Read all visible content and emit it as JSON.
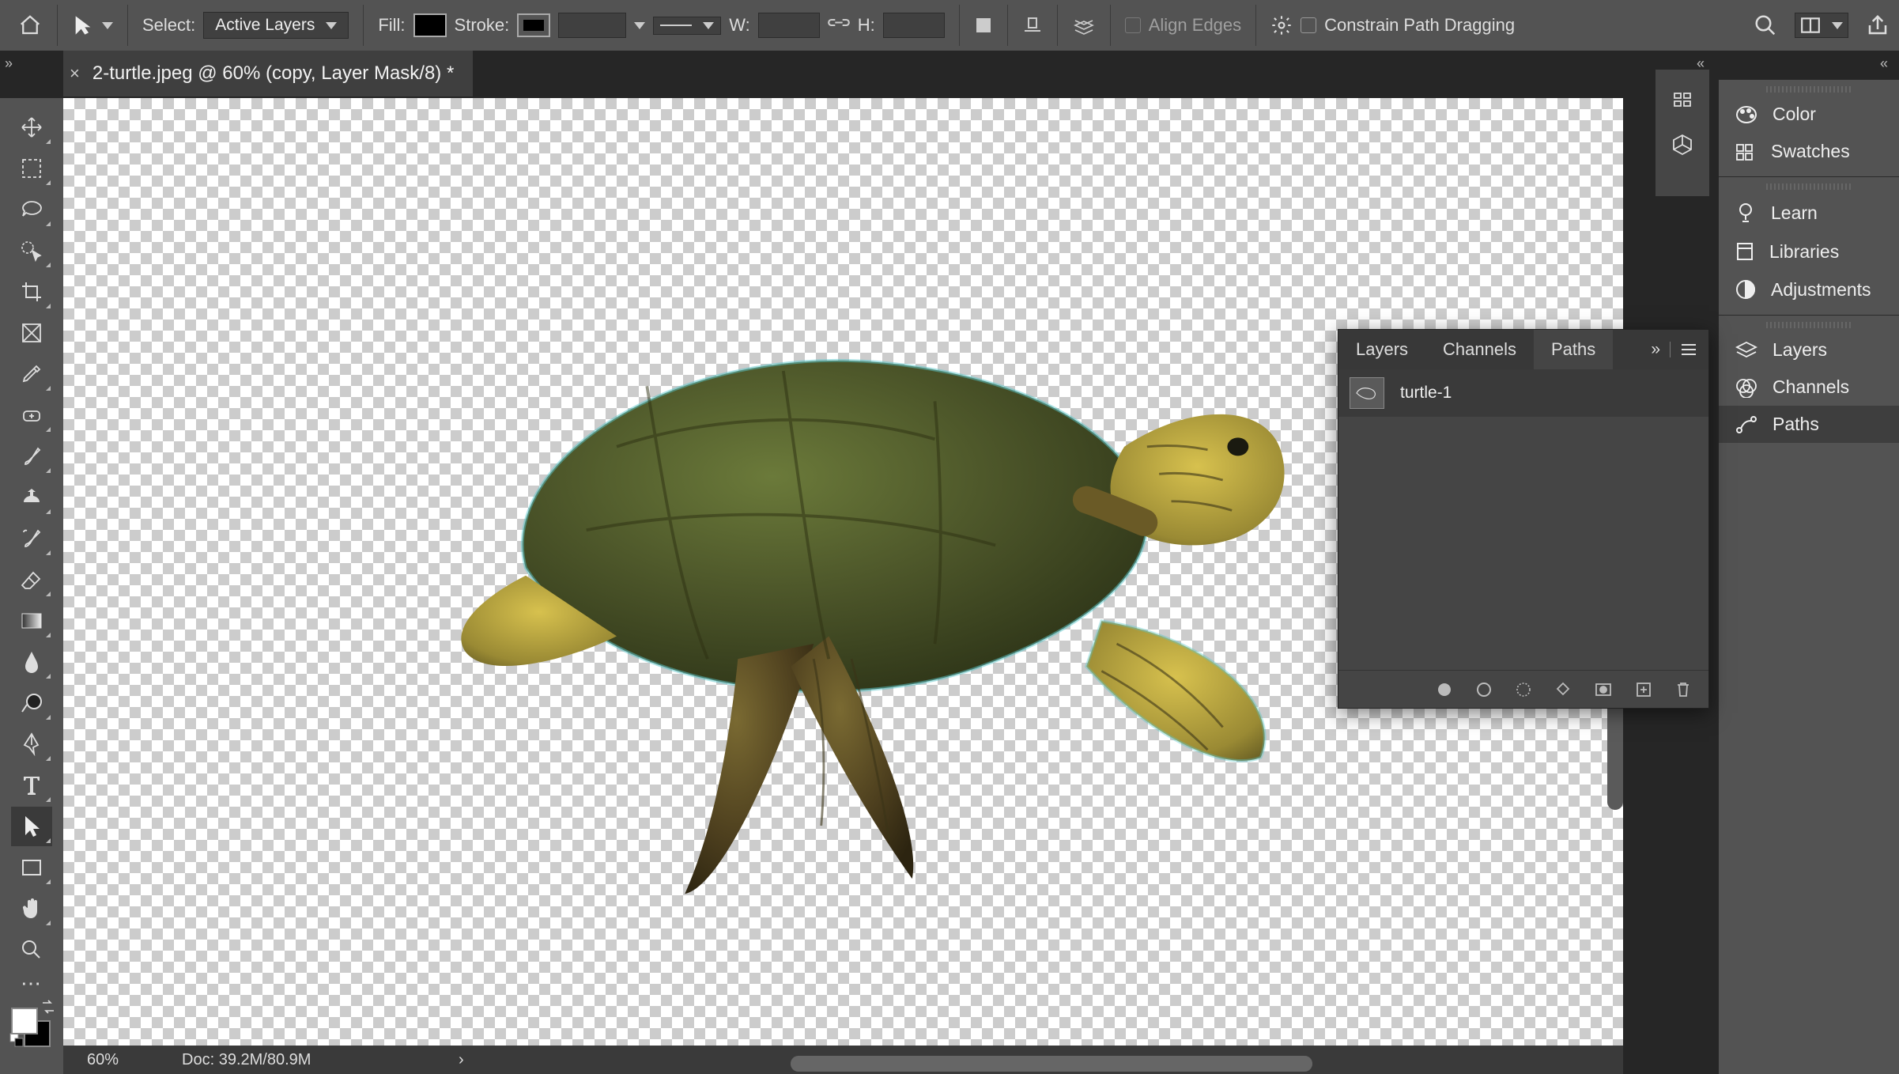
{
  "options": {
    "select_label": "Select:",
    "select_value": "Active Layers",
    "fill_label": "Fill:",
    "fill_color": "#000000",
    "stroke_label": "Stroke:",
    "stroke_color": "#000000",
    "w_label": "W:",
    "w_value": "",
    "h_label": "H:",
    "h_value": "",
    "align_edges": "Align Edges",
    "constrain": "Constrain Path Dragging"
  },
  "document": {
    "title": "2-turtle.jpeg @ 60% (copy, Layer Mask/8) *"
  },
  "status": {
    "zoom": "60%",
    "doc": "Doc: 39.2M/80.9M"
  },
  "float_panel": {
    "tabs": [
      "Layers",
      "Channels",
      "Paths"
    ],
    "active_tab": 2,
    "path_name": "turtle-1"
  },
  "right_panel": {
    "groups": [
      [
        "Color",
        "Swatches"
      ],
      [
        "Learn",
        "Libraries",
        "Adjustments"
      ],
      [
        "Layers",
        "Channels",
        "Paths"
      ]
    ],
    "active": "Paths"
  }
}
